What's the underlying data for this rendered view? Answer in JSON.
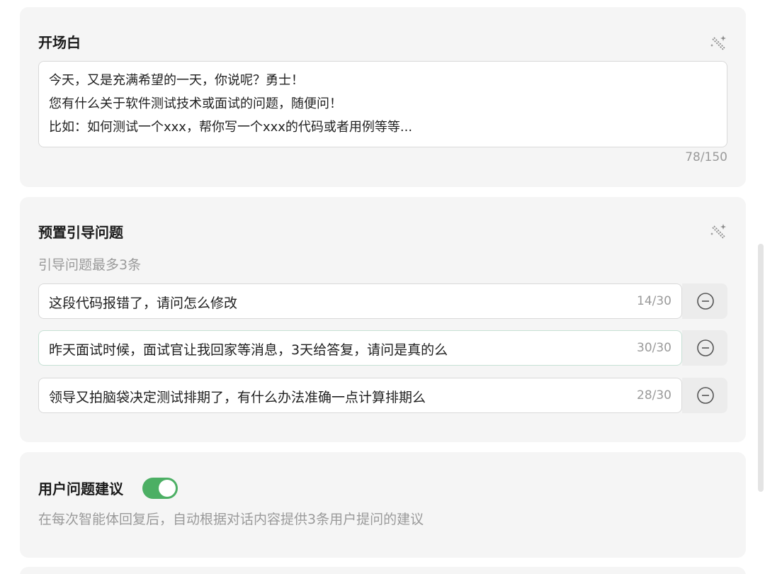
{
  "opening": {
    "title": "开场白",
    "lines": [
      "今天，又是充满希望的一天，你说呢？勇士！",
      "您有什么关于软件测试技术或面试的问题，随便问！",
      "比如：如何测试一个xxx，帮你写一个xxx的代码或者用例等等..."
    ],
    "counter": "78/150"
  },
  "preset": {
    "title": "预置引导问题",
    "subtitle": "引导问题最多3条",
    "questions": [
      {
        "text": "这段代码报错了，请问怎么修改",
        "count": "14/30"
      },
      {
        "text": "昨天面试时候，面试官让我回家等消息，3天给答复，请问是真的么",
        "count": "30/30"
      },
      {
        "text": "领导又拍脑袋决定测试排期了，有什么办法准确一点计算排期么",
        "count": "28/30"
      }
    ]
  },
  "suggest": {
    "title": "用户问题建议",
    "enabled": true,
    "description": "在每次智能体回复后，自动根据对话内容提供3条用户提问的建议"
  },
  "colors": {
    "toggle_on": "#4caf64",
    "card_bg": "#f5f5f5",
    "muted_text": "#9a9a9a"
  },
  "icons": {
    "generate": "magic-wand-icon",
    "remove": "minus-circle-icon"
  }
}
